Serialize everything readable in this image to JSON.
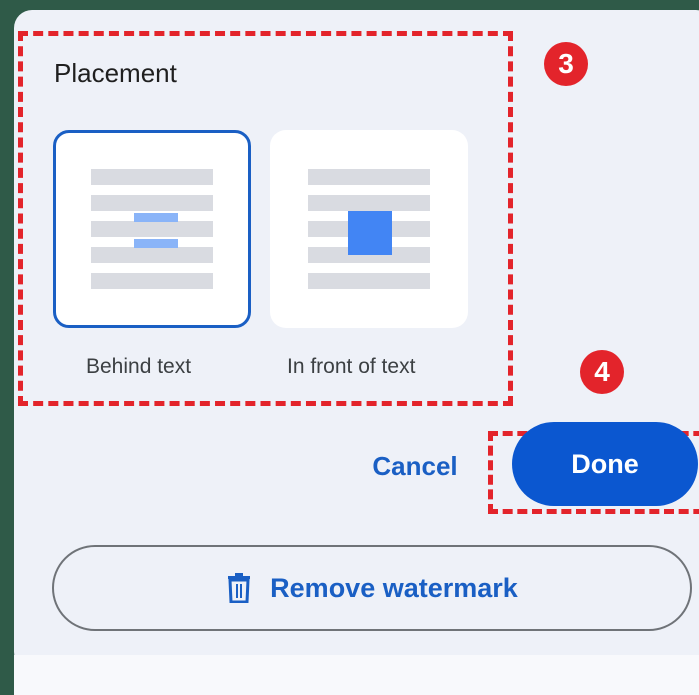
{
  "placement": {
    "title": "Placement",
    "options": [
      {
        "label": "Behind text",
        "selected": true
      },
      {
        "label": "In front of text",
        "selected": false
      }
    ]
  },
  "annotations": {
    "step3": "3",
    "step4": "4",
    "color": "#e3242b"
  },
  "actions": {
    "cancel_label": "Cancel",
    "done_label": "Done",
    "remove_label": "Remove watermark",
    "remove_icon": "trash-icon"
  },
  "colors": {
    "accent": "#0b57d0",
    "link": "#1a5fc4",
    "selected_border": "#1a5fc4",
    "panel": "#eef1f8",
    "background": "#2f5a48"
  }
}
